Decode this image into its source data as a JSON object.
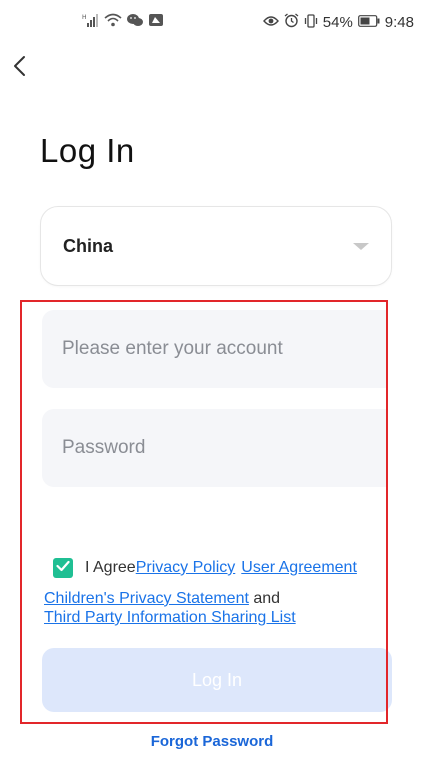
{
  "status_bar": {
    "battery": "54%",
    "time": "9:48"
  },
  "icons": {
    "back": "chevron-left-icon",
    "caret": "chevron-down-icon",
    "check": "check-icon"
  },
  "title": "Log In",
  "country": {
    "selected": "China"
  },
  "account": {
    "placeholder": "Please enter your account"
  },
  "password": {
    "placeholder": "Password"
  },
  "agreement": {
    "checked": true,
    "prefix": "I Agree",
    "privacy_policy": "Privacy Policy",
    "user_agreement": "User Agreement",
    "children_privacy": "Children's Privacy Statement",
    "and": "and",
    "third_party": "Third Party Information Sharing List"
  },
  "login_button": "Log In",
  "forgot_password": "Forgot Password",
  "colors": {
    "accent": "#1a73e8",
    "checkbox": "#1fbf93",
    "button_disabled": "#dde7fb",
    "highlight_frame": "#e2262a"
  }
}
